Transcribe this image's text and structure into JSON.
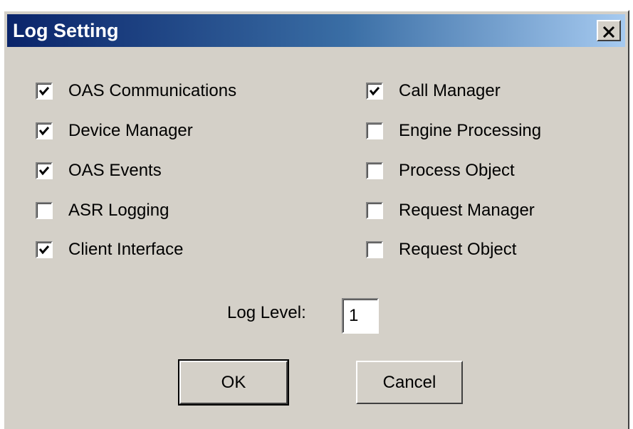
{
  "window": {
    "title": "Log Setting",
    "close_label": "Close"
  },
  "checkboxes": {
    "left": [
      {
        "label": "OAS Communications",
        "checked": true
      },
      {
        "label": "Device Manager",
        "checked": true
      },
      {
        "label": "OAS Events",
        "checked": true
      },
      {
        "label": "ASR Logging",
        "checked": false
      },
      {
        "label": "Client Interface",
        "checked": true
      }
    ],
    "right": [
      {
        "label": "Call Manager",
        "checked": true
      },
      {
        "label": "Engine Processing",
        "checked": false
      },
      {
        "label": "Process Object",
        "checked": false
      },
      {
        "label": "Request Manager",
        "checked": false
      },
      {
        "label": "Request Object",
        "checked": false
      }
    ]
  },
  "log_level": {
    "label": "Log Level:",
    "value": "1"
  },
  "buttons": {
    "ok_label": "OK",
    "cancel_label": "Cancel"
  },
  "colors": {
    "titlebar_start": "#0a246a",
    "titlebar_end": "#a6caf0",
    "dialog_face": "#d4d0c8"
  }
}
